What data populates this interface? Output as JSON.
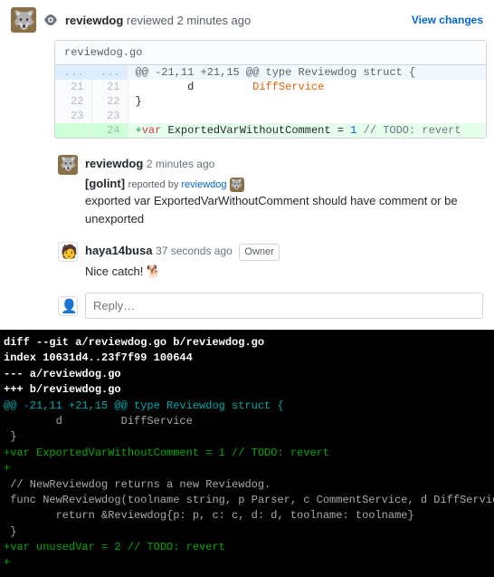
{
  "review": {
    "reviewer": "reviewdog",
    "action_text": "reviewed",
    "time": "2 minutes ago",
    "view_changes": "View changes"
  },
  "file": {
    "name": "reviewdog.go",
    "hunk": "@@ -21,11 +21,15 @@ type Reviewdog struct {",
    "rows": [
      {
        "old": "21",
        "new": "21",
        "code_html": "        d         <span class='tok-type'>DiffService</span>",
        "type": "ctx"
      },
      {
        "old": "22",
        "new": "22",
        "code_html": "}",
        "type": "ctx"
      },
      {
        "old": "23",
        "new": "23",
        "code_html": "",
        "type": "ctx"
      },
      {
        "old": "",
        "new": "24",
        "code_html": "<span class='tok-add'>+</span><span class='tok-kw'>var</span> ExportedVarWithoutComment = <span class='tok-num'>1</span> <span class='tok-comment'>// TODO: revert</span>",
        "type": "add"
      }
    ]
  },
  "comments": [
    {
      "avatar": "wolf",
      "user": "reviewdog",
      "time": "2 minutes ago",
      "badge": "",
      "title": "[golint]",
      "reported_by_label": "reported by",
      "reported_by_link": "reviewdog",
      "body": "exported var ExportedVarWithoutComment should have comment or be unexported"
    },
    {
      "avatar": "haya",
      "user": "haya14busa",
      "time": "37 seconds ago",
      "badge": "Owner",
      "title": "",
      "reported_by_label": "",
      "reported_by_link": "",
      "body": "Nice catch! 🐕"
    }
  ],
  "reply_placeholder": "Reply…",
  "terminal": {
    "lines": [
      {
        "cls": "t-header",
        "text": "diff --git a/reviewdog.go b/reviewdog.go"
      },
      {
        "cls": "t-header",
        "text": "index 10631d4..23f7f99 100644"
      },
      {
        "cls": "t-header",
        "text": "--- a/reviewdog.go"
      },
      {
        "cls": "t-header",
        "text": "+++ b/reviewdog.go"
      },
      {
        "cls": "t-hunk",
        "text": "@@ -21,11 +21,15 @@ type Reviewdog struct {"
      },
      {
        "cls": "t-ctx",
        "text": "        d         DiffService"
      },
      {
        "cls": "t-ctx",
        "text": " }"
      },
      {
        "cls": "t-ctx",
        "text": ""
      },
      {
        "cls": "t-add",
        "text": "+var ExportedVarWithoutComment = 1 // TODO: revert"
      },
      {
        "cls": "t-add",
        "text": "+"
      },
      {
        "cls": "t-ctx",
        "text": " // NewReviewdog returns a new Reviewdog."
      },
      {
        "cls": "t-ctx",
        "text": " func NewReviewdog(toolname string, p Parser, c CommentService, d DiffService) *Reviewdog {"
      },
      {
        "cls": "t-ctx",
        "text": "        return &Reviewdog{p: p, c: c, d: d, toolname: toolname}"
      },
      {
        "cls": "t-ctx",
        "text": " }"
      },
      {
        "cls": "t-ctx",
        "text": ""
      },
      {
        "cls": "t-add",
        "text": "+var unusedVar = 2 // TODO: revert"
      },
      {
        "cls": "t-add",
        "text": "+"
      }
    ]
  }
}
